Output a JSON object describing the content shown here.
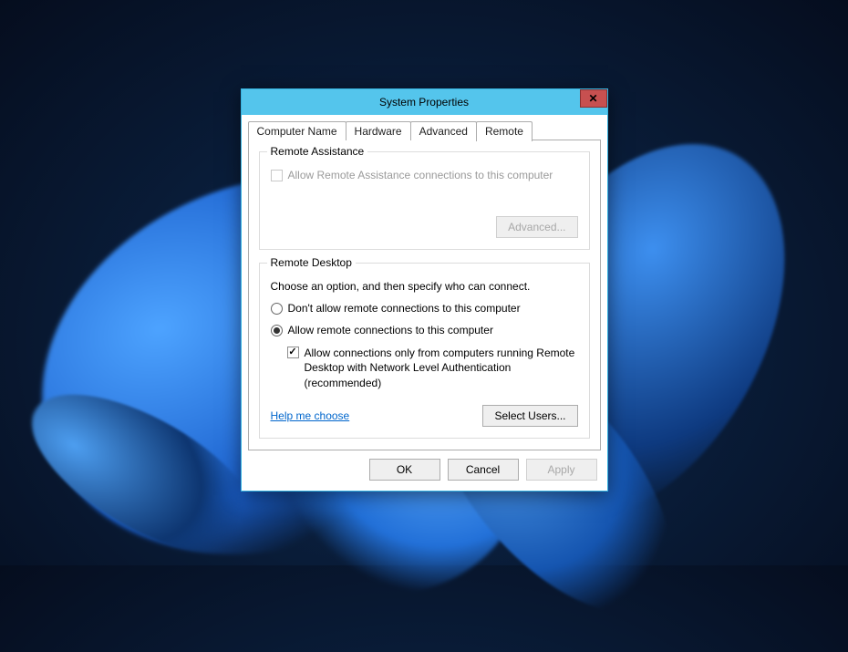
{
  "window": {
    "title": "System Properties"
  },
  "tabs": {
    "computer_name": "Computer Name",
    "hardware": "Hardware",
    "advanced": "Advanced",
    "remote": "Remote"
  },
  "remote_assistance": {
    "group_title": "Remote Assistance",
    "allow_label": "Allow Remote Assistance connections to this computer",
    "advanced_button": "Advanced..."
  },
  "remote_desktop": {
    "group_title": "Remote Desktop",
    "description": "Choose an option, and then specify who can connect.",
    "option_deny": "Don't allow remote connections to this computer",
    "option_allow": "Allow remote connections to this computer",
    "nla_label": "Allow connections only from computers running Remote Desktop with Network Level Authentication (recommended)",
    "help_link": "Help me choose",
    "select_users_button": "Select Users..."
  },
  "dialog": {
    "ok": "OK",
    "cancel": "Cancel",
    "apply": "Apply"
  }
}
